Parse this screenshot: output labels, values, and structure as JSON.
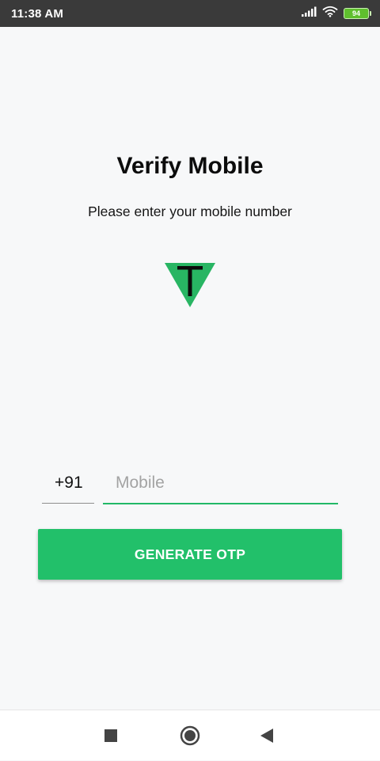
{
  "status_bar": {
    "time": "11:38 AM",
    "battery_level": "94",
    "icons": [
      "signal-icon",
      "wifi-icon",
      "battery-icon"
    ]
  },
  "screen": {
    "title": "Verify Mobile",
    "subtitle": "Please enter your mobile number",
    "logo_icon": "t-triangle-logo-icon"
  },
  "form": {
    "country_code": "+91",
    "mobile_value": "",
    "mobile_placeholder": "Mobile",
    "generate_label": "GENERATE OTP"
  },
  "nav_bar": {
    "icons": [
      "recents-square-icon",
      "home-circle-icon",
      "back-triangle-icon"
    ]
  },
  "colors": {
    "accent": "#22c06a",
    "input_underline_active": "#22b867",
    "status_bar_bg": "#3a3a3a",
    "page_bg": "#f7f8f9",
    "logo_green": "#28b563",
    "battery_green": "#5fbf2e"
  }
}
